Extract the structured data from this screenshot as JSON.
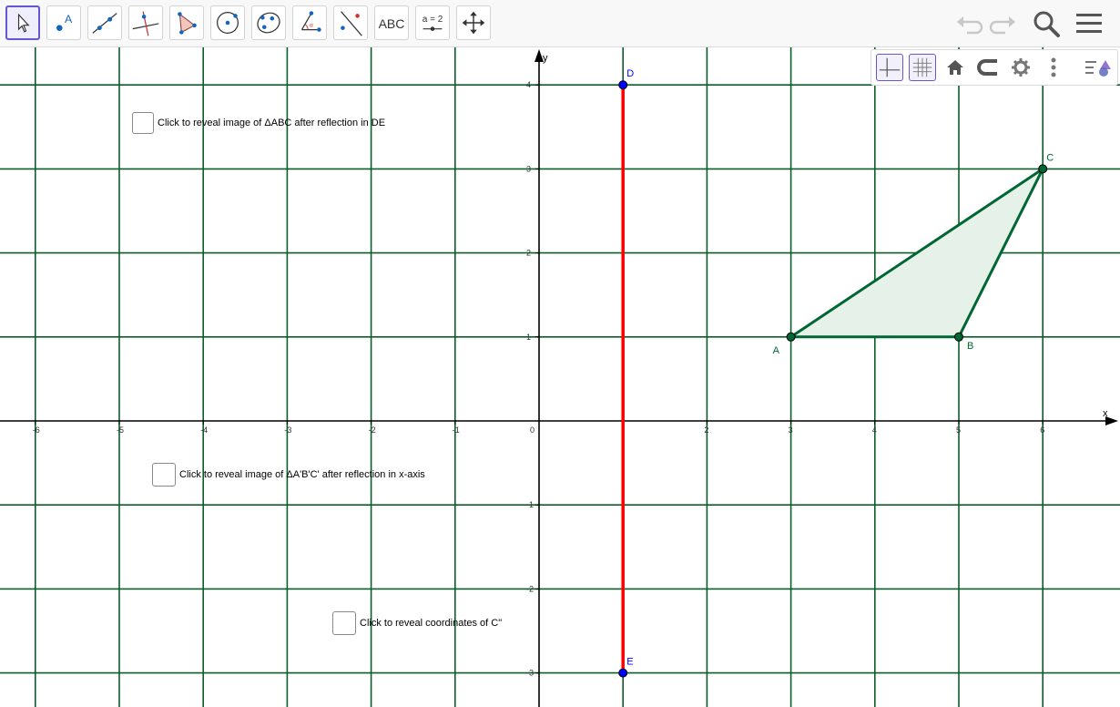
{
  "toolbar": {
    "tools": [
      {
        "name": "move-tool",
        "active": true
      },
      {
        "name": "point-tool"
      },
      {
        "name": "line-tool"
      },
      {
        "name": "perpendicular-line-tool"
      },
      {
        "name": "polygon-tool"
      },
      {
        "name": "circle-tool"
      },
      {
        "name": "conic-tool"
      },
      {
        "name": "angle-tool"
      },
      {
        "name": "reflect-tool"
      },
      {
        "name": "text-tool",
        "label": "ABC"
      },
      {
        "name": "slider-tool",
        "label": "a = 2"
      },
      {
        "name": "move-graphics-view-tool"
      }
    ],
    "right": [
      "undo-icon",
      "redo-icon",
      "search-icon",
      "menu-icon"
    ]
  },
  "stylebar": [
    "axes-toggle",
    "grid-toggle",
    "home-icon",
    "magnet-icon",
    "gear-icon",
    "more-vertical-icon",
    "style-panel-icon"
  ],
  "graphics": {
    "x_ticks": [
      "-6",
      "-5",
      "-4",
      "-3",
      "-2",
      "-1",
      "0",
      "2",
      "3",
      "4",
      "5",
      "6"
    ],
    "y_ticks": [
      "4",
      "3",
      "2",
      "1",
      "-1",
      "-2",
      "-3"
    ],
    "x_axis_label": "x",
    "y_axis_label": "y",
    "points": {
      "A": {
        "label": "A",
        "x": 3,
        "y": 1
      },
      "B": {
        "label": "B",
        "x": 5,
        "y": 1
      },
      "C": {
        "label": "C",
        "x": 6,
        "y": 3
      },
      "D": {
        "label": "D",
        "x": 1,
        "y": 4
      },
      "E": {
        "label": "E",
        "x": 1,
        "y": -3
      }
    },
    "colors": {
      "grid": "#0b5d2a",
      "triangle": "#006633",
      "triangle_fill": "#e6f1ea",
      "mirror": "#ff0000",
      "mirror_point": "#0000ff"
    }
  },
  "checkboxes": {
    "reflect_de": {
      "label": "Click to reveal image of ΔABC after reflection in DE",
      "checked": false
    },
    "reflect_x": {
      "label": "Click to reveal image of ΔA'B'C' after reflection in x-axis",
      "checked": false
    },
    "coords_c": {
      "label": "Click to reveal coordinates of C\"",
      "checked": false
    }
  }
}
